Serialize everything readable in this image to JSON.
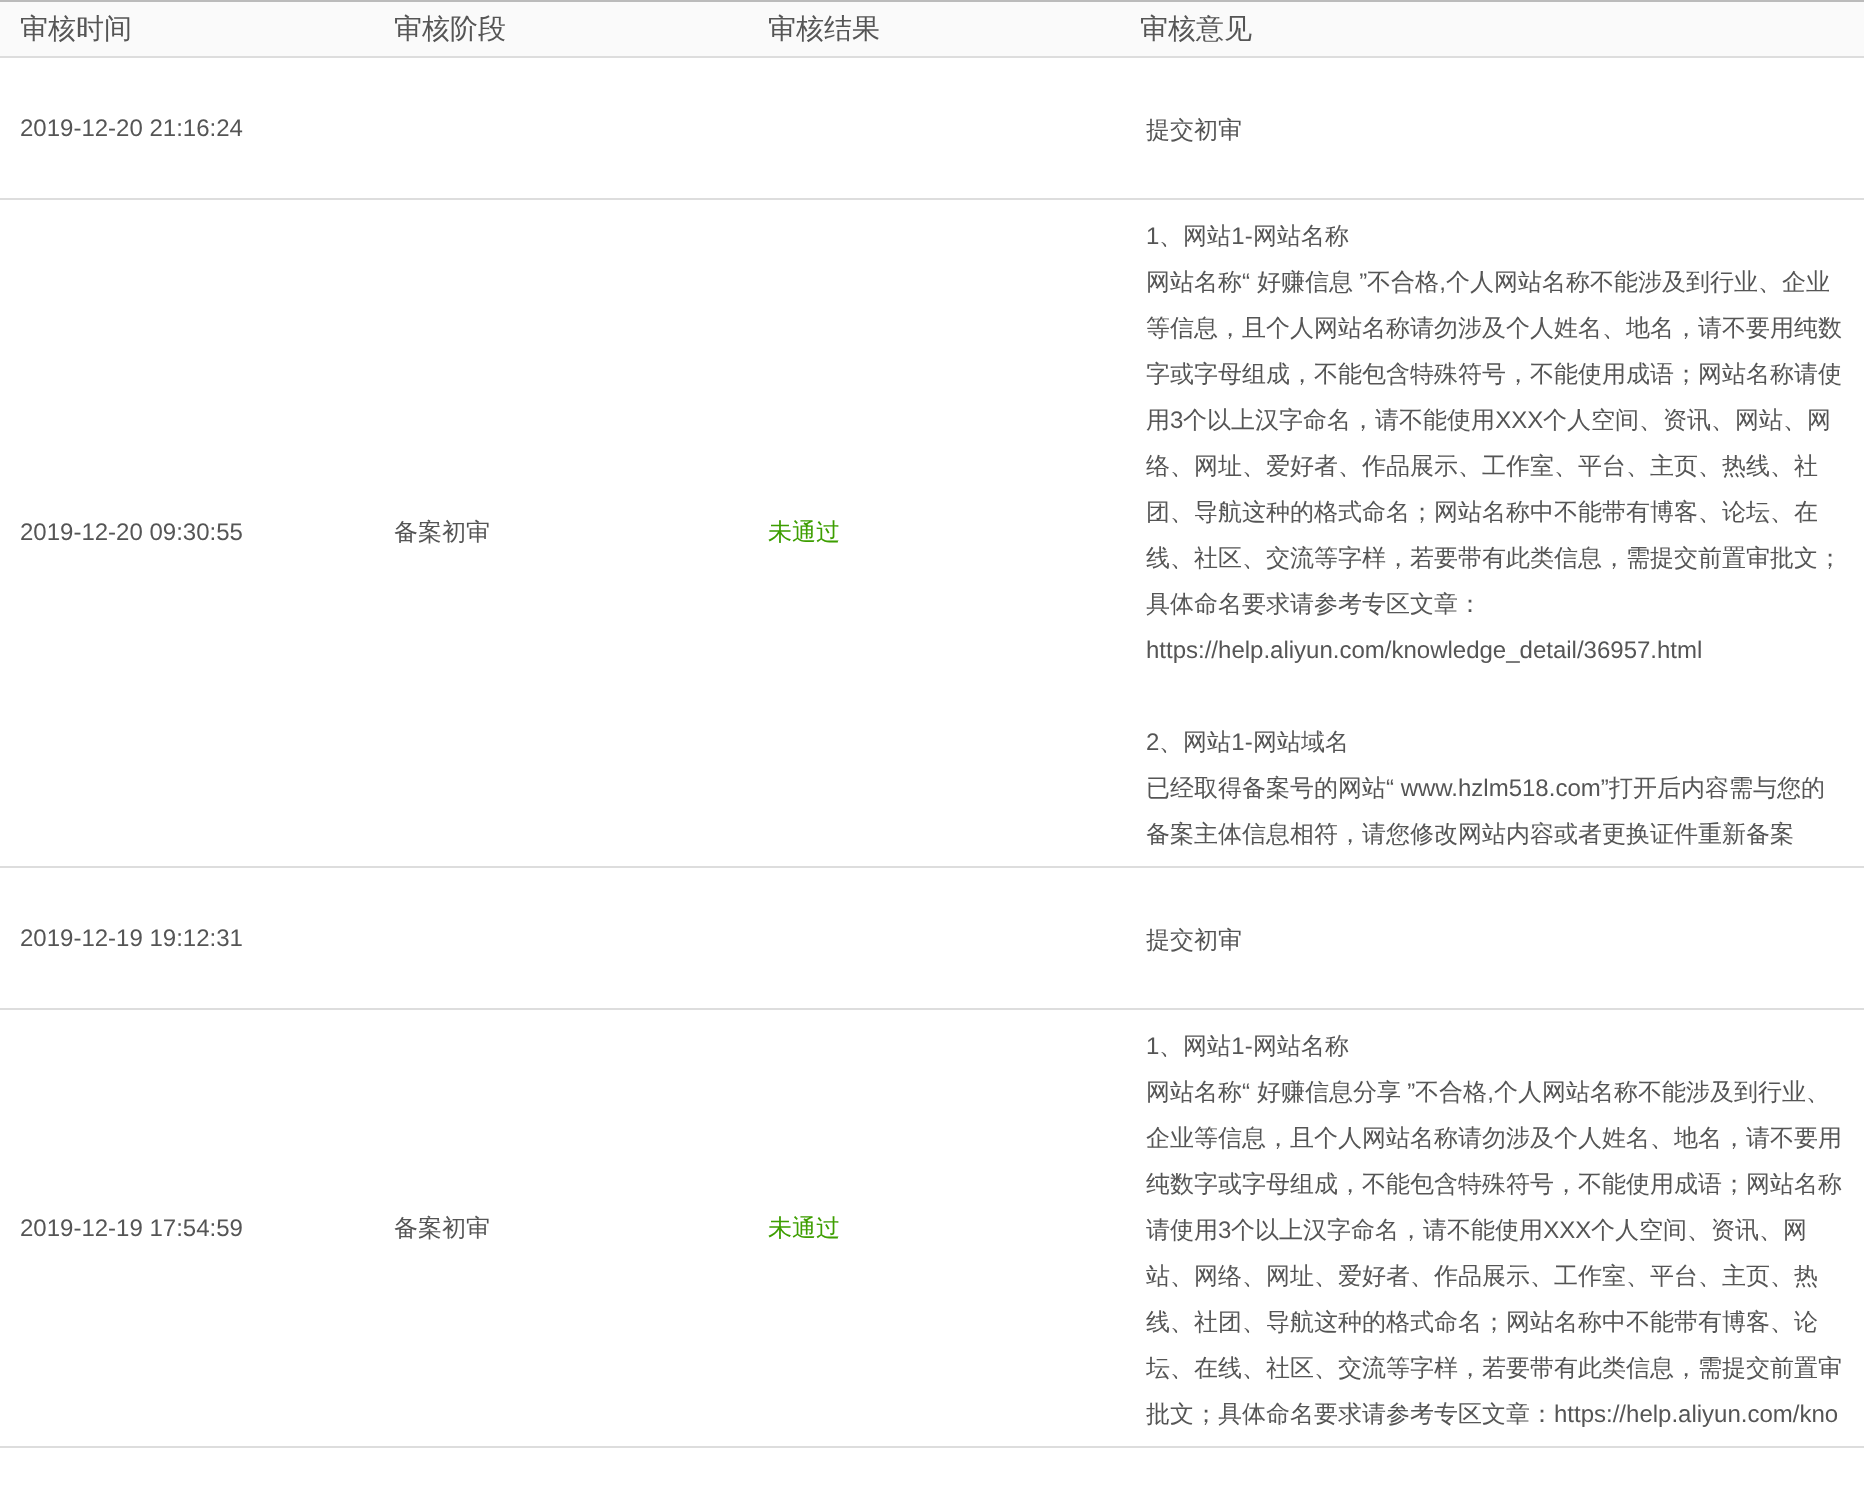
{
  "table": {
    "columns": [
      "审核时间",
      "审核阶段",
      "审核结果",
      "审核意见"
    ],
    "rows": [
      {
        "time": "2019-12-20 21:16:24",
        "comments": [
          {
            "text": "提交初审"
          }
        ]
      },
      {
        "time": "2019-12-20 09:30:55",
        "stage": "备案初审",
        "result": {
          "text": "未通过",
          "color": "#3d9e00"
        },
        "comments": [
          {
            "title": "1、网站1-网站名称",
            "text": "网站名称“ 好赚信息 ”不合格,个人网站名称不能涉及到行业、企业等信息，且个人网站名称请勿涉及个人姓名、地名，请不要用纯数字或字母组成，不能包含特殊符号，不能使用成语；网站名称请使用3个以上汉字命名，请不能使用XXX个人空间、资讯、网站、网络、网址、爱好者、作品展示、工作室、平台、主页、热线、社团、导航这种的格式命名；网站名称中不能带有博客、论坛、在线、社区、交流等字样，若要带有此类信息，需提交前置审批文；具体命名要求请参考专区文章：https://help.aliyun.com/knowledge_detail/36957.html"
          },
          {
            "title": "2、网站1-网站域名",
            "text": "已经取得备案号的网站“ www.hzlm518.com”打开后内容需与您的备案主体信息相符，请您修改网站内容或者更换证件重新备案"
          }
        ]
      },
      {
        "time": "2019-12-19 19:12:31",
        "comments": [
          {
            "text": "提交初审"
          }
        ]
      },
      {
        "time": "2019-12-19 17:54:59",
        "stage": "备案初审",
        "result": {
          "text": "未通过",
          "color": "#3d9e00"
        },
        "comments": [
          {
            "title": "1、网站1-网站名称",
            "text": "网站名称“ 好赚信息分享 ”不合格,个人网站名称不能涉及到行业、企业等信息，且个人网站名称请勿涉及个人姓名、地名，请不要用纯数字或字母组成，不能包含特殊符号，不能使用成语；网站名称请使用3个以上汉字命名，请不能使用XXX个人空间、资讯、网站、网络、网址、爱好者、作品展示、工作室、平台、主页、热线、社团、导航这种的格式命名；网站名称中不能带有博客、论坛、在线、社区、交流等字样，若要带有此类信息，需提交前置审批文；具体命名要求请参考专区文章：https://help.aliyun.com/kno"
          }
        ]
      }
    ]
  }
}
